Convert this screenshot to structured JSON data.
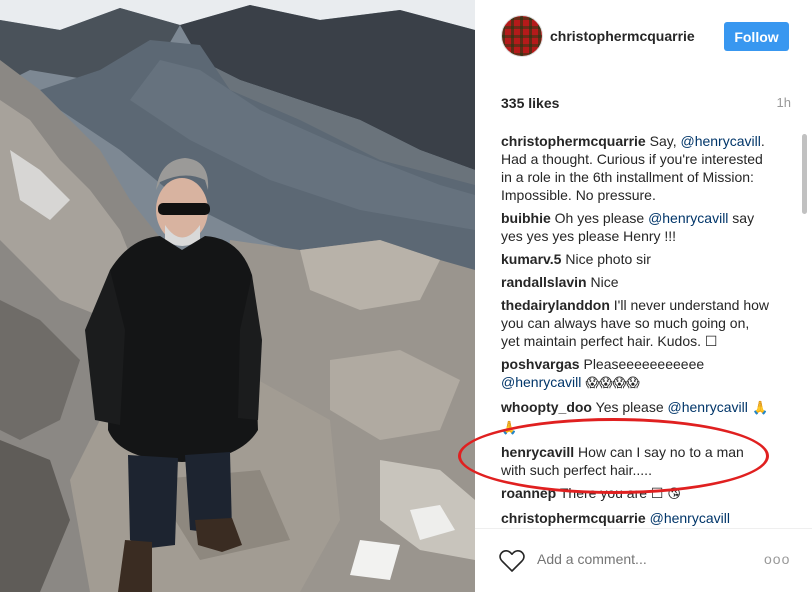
{
  "post": {
    "username": "christophermcquarrie",
    "follow_label": "Follow",
    "likes": "335 likes",
    "time": "1h"
  },
  "comments": [
    {
      "user": "christophermcquarrie",
      "parts": [
        {
          "t": " Say, "
        },
        {
          "t": "@henrycavill",
          "m": true
        },
        {
          "t": ". Had a thought. Curious if you're interested in a role in the 6th installment of Mission: Impossible. No pressure."
        }
      ]
    },
    {
      "user": "buibhie",
      "parts": [
        {
          "t": " Oh yes please "
        },
        {
          "t": "@henrycavill",
          "m": true
        },
        {
          "t": " say yes yes yes please Henry !!!"
        }
      ]
    },
    {
      "user": "kumarv.5",
      "parts": [
        {
          "t": " Nice photo sir"
        }
      ]
    },
    {
      "user": "randallslavin",
      "parts": [
        {
          "t": " Nice"
        }
      ]
    },
    {
      "user": "thedairylanddon",
      "parts": [
        {
          "t": " I'll never understand how you can always have so much going on, yet maintain perfect hair. Kudos. ☐"
        }
      ]
    },
    {
      "user": "poshvargas",
      "parts": [
        {
          "t": " Pleaseeeeeeeeeee "
        },
        {
          "t": "@henrycavill",
          "m": true
        },
        {
          "t": " 😱😱😱😱",
          "e": true
        }
      ]
    },
    {
      "user": "whoopty_doo",
      "parts": [
        {
          "t": " Yes please "
        },
        {
          "t": "@henrycavill",
          "m": true
        },
        {
          "t": " 🙏🙏",
          "e": true
        }
      ]
    },
    {
      "user": "henrycavill",
      "parts": [
        {
          "t": " How can I say no to a man with such perfect hair....."
        }
      ]
    },
    {
      "user": "roannep",
      "parts": [
        {
          "t": " There you are ☐ "
        },
        {
          "t": "😘",
          "e": true
        }
      ]
    },
    {
      "user": "christophermcquarrie",
      "parts": [
        {
          "t": " "
        },
        {
          "t": "@henrycavill",
          "m": true
        }
      ]
    }
  ],
  "footer": {
    "add_comment_placeholder": "Add a comment...",
    "more_label": "ooo"
  },
  "colors": {
    "follow_button": "#3897f0",
    "mention": "#003569",
    "annotation_circle": "#e02020"
  },
  "icons": {
    "like": "heart-icon",
    "more": "more-options-icon"
  }
}
